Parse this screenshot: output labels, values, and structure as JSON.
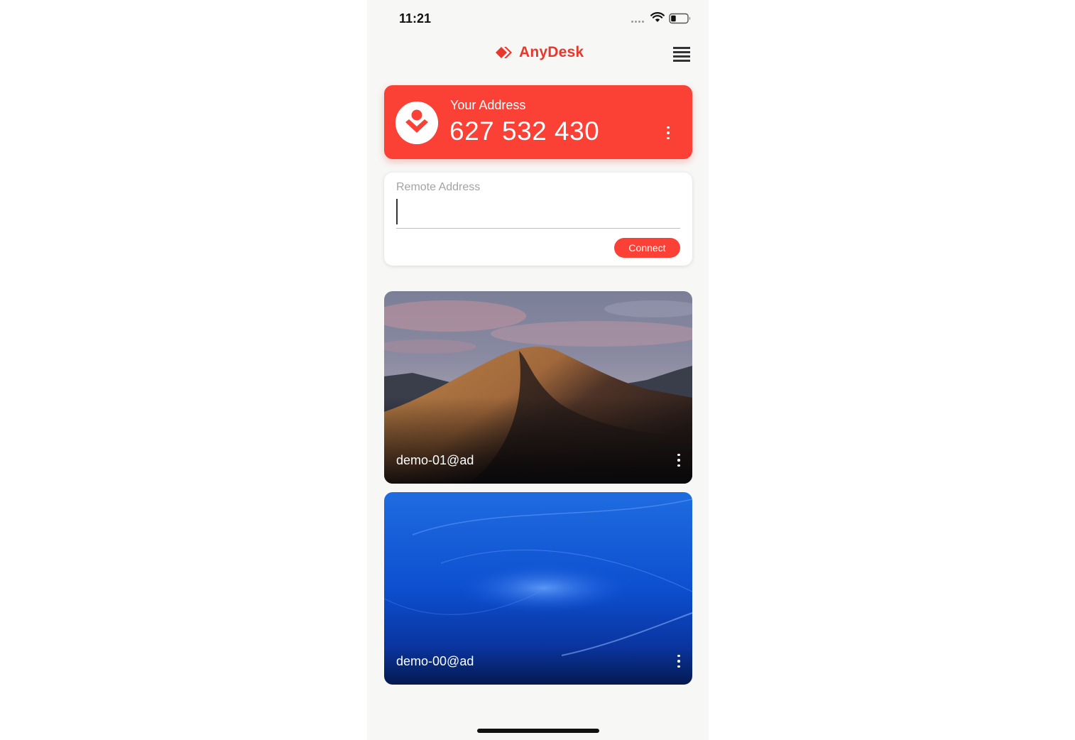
{
  "status_bar": {
    "time": "11:21",
    "icons": [
      "signal-dots-icon",
      "wifi-icon",
      "battery-icon"
    ]
  },
  "header": {
    "app_name": "AnyDesk",
    "logo_icon": "anydesk-diamond-icon",
    "menu_icon": "hamburger-menu-icon"
  },
  "your_address": {
    "label": "Your Address",
    "number": "627 532 430",
    "avatar_icon": "user-badge-icon",
    "more_icon": "vertical-ellipsis-icon"
  },
  "remote": {
    "label": "Remote Address",
    "value": "",
    "connect_label": "Connect"
  },
  "sessions": [
    {
      "name": "demo-01@ad",
      "thumbnail": "desert-dunes-wallpaper",
      "more_icon": "vertical-ellipsis-icon"
    },
    {
      "name": "demo-00@ad",
      "thumbnail": "blue-wave-wallpaper",
      "more_icon": "vertical-ellipsis-icon"
    }
  ],
  "colors": {
    "accent": "#fb4136",
    "brand_text": "#e8372c",
    "background": "#f7f7f5"
  }
}
